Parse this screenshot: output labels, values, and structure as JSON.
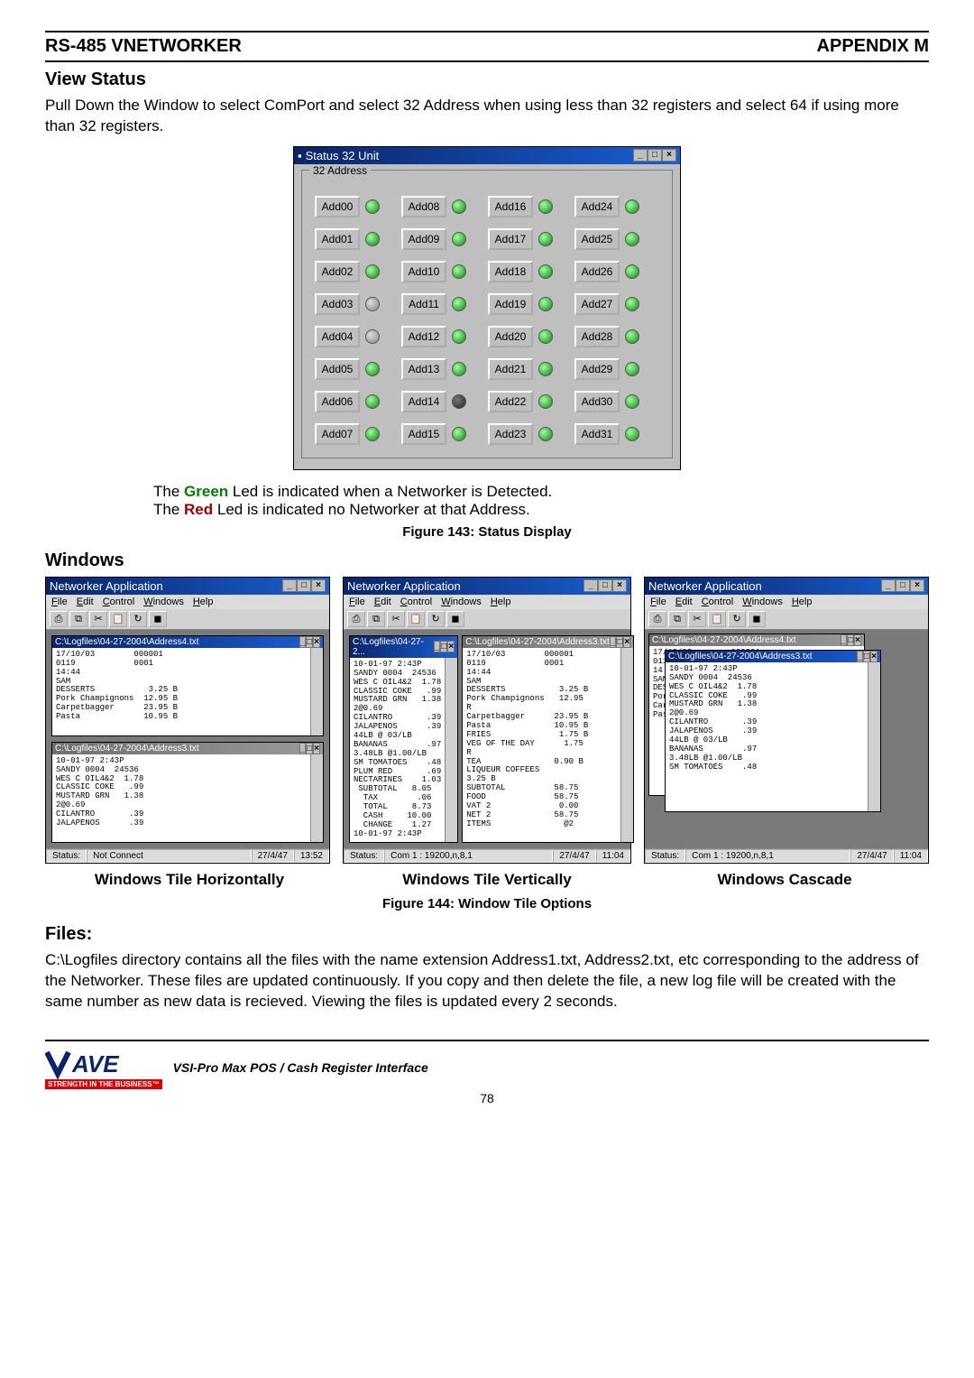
{
  "header": {
    "left": "RS-485 VNETWORKER",
    "right": "APPENDIX M"
  },
  "view_status": {
    "title": "View Status",
    "paragraph": "Pull Down the Window to select ComPort and select 32 Address when using less than 32 registers and select 64 if using more than 32 registers."
  },
  "status_window": {
    "title": "Status 32 Unit",
    "group_legend": "32 Address",
    "cells": [
      [
        {
          "label": "Add00",
          "led": "green"
        },
        {
          "label": "Add01",
          "led": "green"
        },
        {
          "label": "Add02",
          "led": "green"
        },
        {
          "label": "Add03",
          "led": "off"
        },
        {
          "label": "Add04",
          "led": "off"
        },
        {
          "label": "Add05",
          "led": "green"
        },
        {
          "label": "Add06",
          "led": "green"
        },
        {
          "label": "Add07",
          "led": "green"
        }
      ],
      [
        {
          "label": "Add08",
          "led": "green"
        },
        {
          "label": "Add09",
          "led": "green"
        },
        {
          "label": "Add10",
          "led": "green"
        },
        {
          "label": "Add11",
          "led": "green"
        },
        {
          "label": "Add12",
          "led": "green"
        },
        {
          "label": "Add13",
          "led": "green"
        },
        {
          "label": "Add14",
          "led": "dark"
        },
        {
          "label": "Add15",
          "led": "green"
        }
      ],
      [
        {
          "label": "Add16",
          "led": "green"
        },
        {
          "label": "Add17",
          "led": "green"
        },
        {
          "label": "Add18",
          "led": "green"
        },
        {
          "label": "Add19",
          "led": "green"
        },
        {
          "label": "Add20",
          "led": "green"
        },
        {
          "label": "Add21",
          "led": "green"
        },
        {
          "label": "Add22",
          "led": "green"
        },
        {
          "label": "Add23",
          "led": "green"
        }
      ],
      [
        {
          "label": "Add24",
          "led": "green"
        },
        {
          "label": "Add25",
          "led": "green"
        },
        {
          "label": "Add26",
          "led": "green"
        },
        {
          "label": "Add27",
          "led": "green"
        },
        {
          "label": "Add28",
          "led": "green"
        },
        {
          "label": "Add29",
          "led": "green"
        },
        {
          "label": "Add30",
          "led": "green"
        },
        {
          "label": "Add31",
          "led": "green"
        }
      ]
    ]
  },
  "led_note": {
    "green_line_pre": "The ",
    "green_word": "Green",
    "green_line_post": " Led is indicated when a Networker is Detected.",
    "red_line_pre": "The ",
    "red_word": "Red",
    "red_line_post": " Led is indicated no Networker at that Address."
  },
  "figure143": "Figure 143: Status Display",
  "windows": {
    "title": "Windows"
  },
  "app": {
    "title": "Networker Application",
    "menus": [
      "File",
      "Edit",
      "Control",
      "Windows",
      "Help"
    ],
    "toolbar_icons": [
      "print-icon",
      "copy-icon",
      "cut-icon",
      "paste-icon",
      "refresh-icon",
      "stop-icon"
    ],
    "doc_titles": {
      "a4": "C:\\Logfiles\\04-27-2004\\Address4.txt",
      "a3": "C:\\Logfiles\\04-27-2004\\Address3.txt",
      "a2": "C:\\Logfiles\\04-27-2..."
    },
    "receipt1": "17/10/03        000001\n0119            0001\n14:44\nSAM\nDESSERTS           3.25 B\nPork Champignons  12.95 B\nCarpetbagger      23.95 B\nPasta             10.95 B",
    "receipt2": "10-01-97 2:43P\nSANDY 0004  24536\nWES C OIL4&2  1.78\nCLASSIC COKE   .99\nMUSTARD GRN   1.38\n2@0.69\nCILANTRO       .39\nJALAPENOS      .39",
    "receipt_vert_left": "10-01-97 2:43P\nSANDY 0004  24536\nWES C OIL4&2  1.78\nCLASSIC COKE   .99\nMUSTARD GRN   1.38\n2@0.69\nCILANTRO       .39\nJALAPENOS      .39\n44LB @ 03/LB\nBANANAS        .97\n3.48LB @1.00/LB\nSM TOMATOES    .48\nPLUM RED       .69\nNECTARINES    1.03\n SUBTOTAL   8.05\n  TAX        .06\n  TOTAL     8.73\n  CASH     10.00\n  CHANGE    1.27\n10-01-97 2:43P",
    "receipt_vert_right": "17/10/03        000001\n0119            0001\n14:44\nSAM\nDESSERTS           3.25 B\nPork Champignons   12.95\nR\nCarpetbagger      23.95 B\nPasta             10.95 B\nFRIES              1.75 B\nVEG OF THE DAY      1.75\nR\nTEA               0.90 B\nLIQUEUR COFFEES\n3.25 B\nSUBTOTAL          58.75\nFOOD              58.75\nVAT 2              0.00\nNET 2             58.75\nITEMS               @2",
    "receipt_casc": "10-01-97 2:43P\nSANDY 0004  24536\nWES C OIL4&2  1.78\nCLASSIC COKE   .99\nMUSTARD GRN   1.38\n2@0.69\nCILANTRO       .39\nJALAPENOS      .39\n44LB @ 03/LB\nBANANAS        .97\n3.48LB @1.00/LB\nSM TOMATOES    .48",
    "status": {
      "not_connect": "Not Connect",
      "com": "Com 1 : 19200,n,8,1",
      "label": "Status:",
      "date": "27/4/47",
      "time1": "13:52",
      "time2": "11:04"
    }
  },
  "three_captions": [
    "Windows Tile Horizontally",
    "Windows Tile Vertically",
    "Windows Cascade"
  ],
  "figure144": "Figure 144: Window Tile Options",
  "files": {
    "title": "Files:",
    "paragraph": "C:\\Logfiles directory contains all the files with the name extension Address1.txt, Address2.txt, etc corresponding to the address of the Networker. These files are updated continuously. If you copy and then delete the file, a new log file will be created with the same number as new data is recieved. Viewing the files is updated every 2 seconds."
  },
  "footer": {
    "logo_text": "AVE",
    "logo_tag": "STRENGTH IN THE BUSINESS™",
    "product": "VSI-Pro Max  POS / Cash Register Interface",
    "page": "78"
  }
}
